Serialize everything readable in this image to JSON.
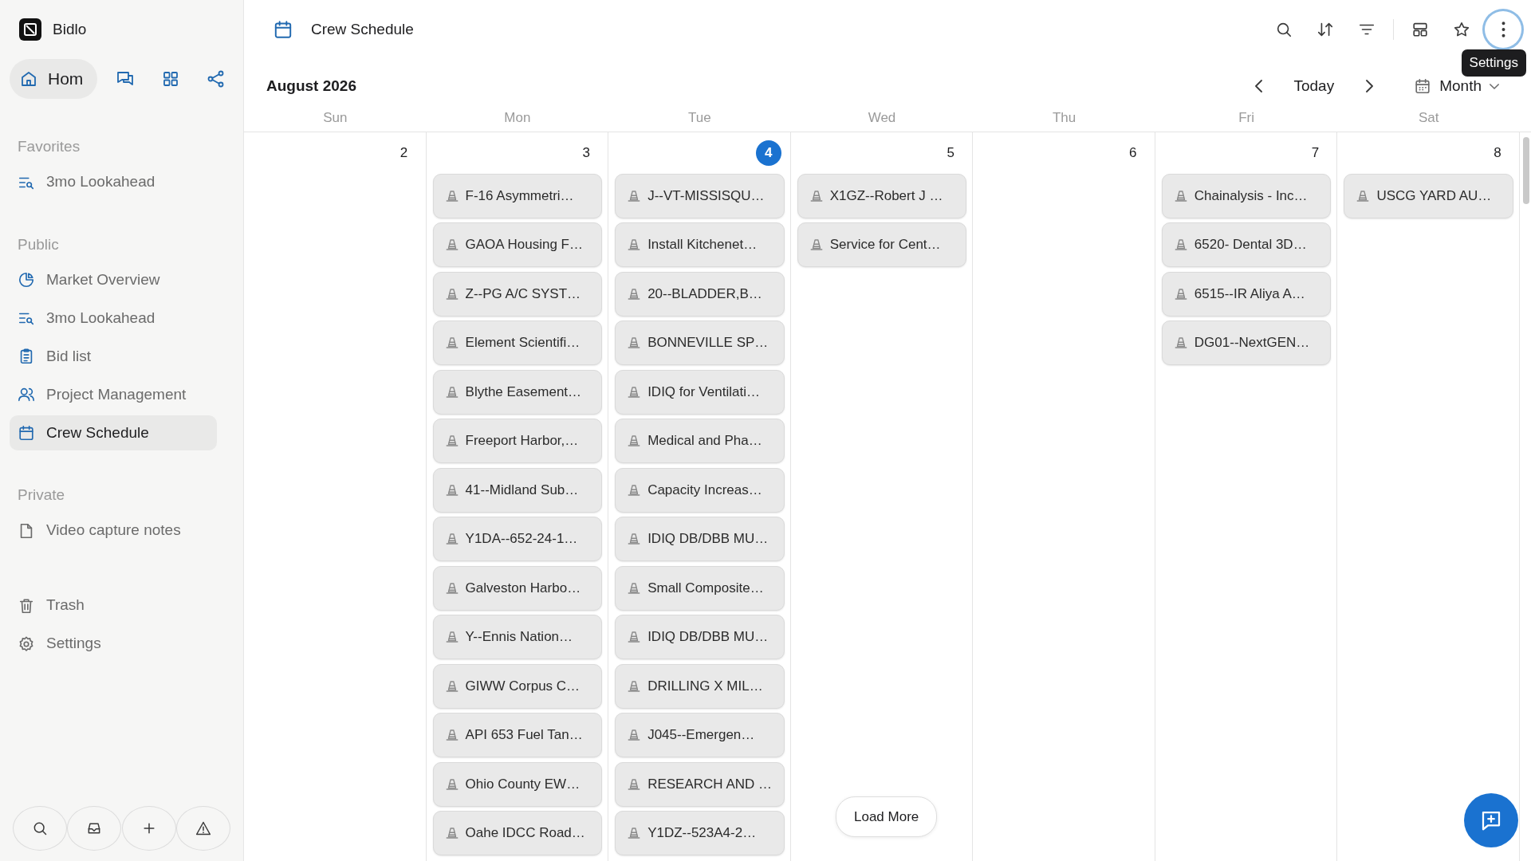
{
  "app": {
    "name": "Bidlo"
  },
  "top_nav": [
    {
      "kind": "home",
      "label": "Hom",
      "selected": true
    },
    {
      "kind": "chat",
      "selected": false
    },
    {
      "kind": "grid",
      "selected": false
    },
    {
      "kind": "share",
      "selected": false
    }
  ],
  "sidebar": {
    "sections": [
      {
        "heading": "Favorites",
        "items": [
          {
            "kind": "list-search",
            "label": "3mo Lookahead",
            "selected": false
          }
        ]
      },
      {
        "heading": "Public",
        "items": [
          {
            "kind": "pie",
            "label": "Market Overview",
            "selected": false
          },
          {
            "kind": "list-search",
            "label": "3mo Lookahead",
            "selected": false
          },
          {
            "kind": "clipboard",
            "label": "Bid list",
            "selected": false
          },
          {
            "kind": "people",
            "label": "Project Management",
            "selected": false
          },
          {
            "kind": "calendar",
            "label": "Crew Schedule",
            "selected": true
          }
        ]
      },
      {
        "heading": "Private",
        "items": [
          {
            "kind": "document",
            "label": "Video capture notes",
            "selected": false
          }
        ]
      }
    ],
    "bottom_items": [
      {
        "kind": "trash",
        "label": "Trash"
      },
      {
        "kind": "gear",
        "label": "Settings"
      }
    ]
  },
  "footer_buttons": [
    {
      "kind": "search"
    },
    {
      "kind": "inbox"
    },
    {
      "kind": "plus"
    },
    {
      "kind": "warning"
    }
  ],
  "header": {
    "title": "Crew Schedule",
    "toolbar": [
      {
        "kind": "search",
        "focused": false
      },
      {
        "kind": "sort",
        "focused": false
      },
      {
        "kind": "filter",
        "focused": false
      },
      {
        "kind": "divider"
      },
      {
        "kind": "layout",
        "focused": false
      },
      {
        "kind": "star",
        "focused": false
      },
      {
        "kind": "more",
        "focused": true
      }
    ],
    "tooltip": "Settings"
  },
  "calendar": {
    "month": "August 2026",
    "today_button": "Today",
    "view": "Month",
    "weekdays": [
      "Sun",
      "Mon",
      "Tue",
      "Wed",
      "Thu",
      "Fri",
      "Sat"
    ],
    "days": [
      {
        "number": "2",
        "today": false
      },
      {
        "number": "3",
        "today": false,
        "events": [
          "F-16 Asymmetri…",
          "GAOA Housing F…",
          "Z--PG A/C SYST…",
          "Element Scientifi…",
          "Blythe Easement…",
          "Freeport Harbor,…",
          "41--Midland Sub…",
          "Y1DA--652-24-1…",
          "Galveston Harbo…",
          "Y--Ennis Nation…",
          "GIWW Corpus C…",
          "API 653 Fuel Tan…",
          "Ohio County EW…",
          "Oahe IDCC Road…"
        ]
      },
      {
        "number": "4",
        "today": true,
        "events": [
          "J--VT-MISSISQU…",
          "Install Kitchenet…",
          "20--BLADDER,B…",
          "BONNEVILLE SP…",
          "IDIQ for Ventilati…",
          "Medical and Pha…",
          "Capacity Increas…",
          "IDIQ DB/DBB MU…",
          "Small Composite…",
          "IDIQ DB/DBB MU…",
          "DRILLING X MIL…",
          "J045--Emergen…",
          "RESEARCH AND …",
          "Y1DZ--523A4-2…"
        ]
      },
      {
        "number": "5",
        "today": false,
        "events": [
          "X1GZ--Robert J …",
          "Service for Cent…"
        ]
      },
      {
        "number": "6",
        "today": false
      },
      {
        "number": "7",
        "today": false,
        "events": [
          "Chainalysis - Inc…",
          "6520- Dental 3D…",
          "6515--IR Aliya A…",
          "DG01--NextGEN…"
        ]
      },
      {
        "number": "8",
        "today": false,
        "events": [
          "USCG YARD AU…"
        ]
      }
    ],
    "load_more": "Load More"
  }
}
